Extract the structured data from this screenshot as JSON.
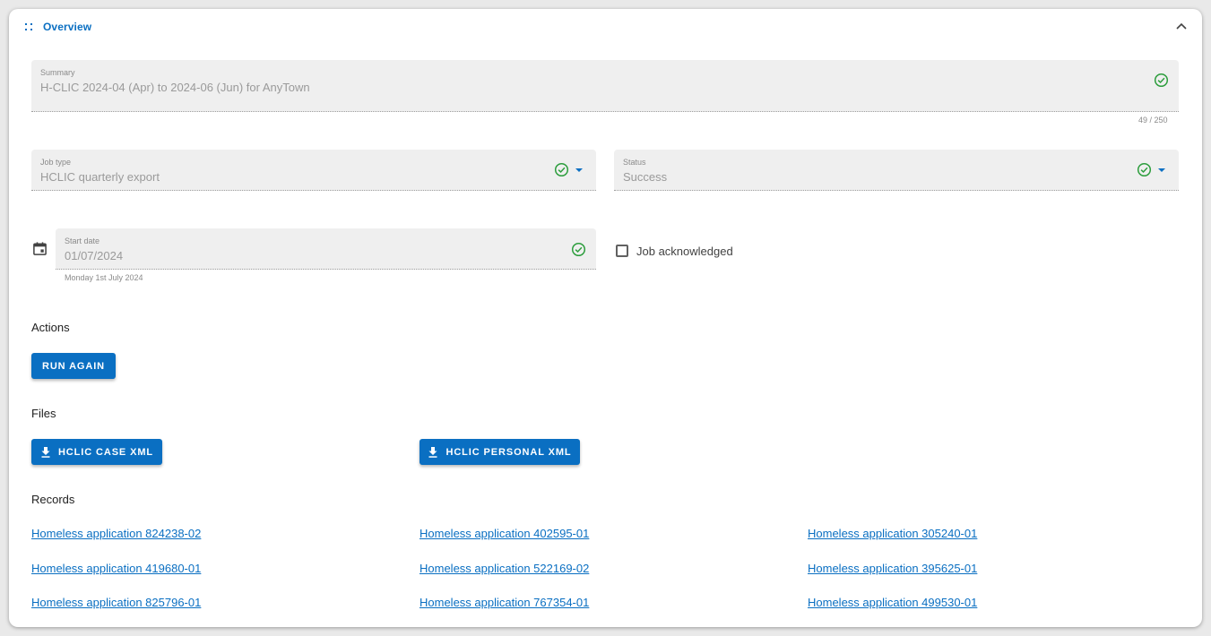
{
  "panel": {
    "title": "Overview",
    "collapse_icon": "chevron-up-icon",
    "drag_icon": "drag-handle-icon"
  },
  "summary": {
    "label": "Summary",
    "value": "H-CLIC 2024-04 (Apr) to 2024-06 (Jun) for AnyTown",
    "counter": "49 / 250"
  },
  "job_type": {
    "label": "Job type",
    "value": "HCLIC quarterly export"
  },
  "status": {
    "label": "Status",
    "value": "Success"
  },
  "start_date": {
    "label": "Start date",
    "value": "01/07/2024",
    "hint": "Monday 1st July 2024"
  },
  "acknowledged": {
    "label": "Job acknowledged",
    "checked": false
  },
  "actions": {
    "title": "Actions",
    "run_again": "RUN AGAIN"
  },
  "files": {
    "title": "Files",
    "items": [
      "HCLIC CASE XML",
      "HCLIC PERSONAL XML"
    ]
  },
  "records": {
    "title": "Records",
    "items": [
      "Homeless application 824238-02",
      "Homeless application 402595-01",
      "Homeless application 305240-01",
      "Homeless application 419680-01",
      "Homeless application 522169-02",
      "Homeless application 395625-01",
      "Homeless application 825796-01",
      "Homeless application 767354-01",
      "Homeless application 499530-01"
    ]
  },
  "colors": {
    "accent": "#0a6fc2",
    "success": "#2e9e3e",
    "field_bg": "#efefef"
  }
}
